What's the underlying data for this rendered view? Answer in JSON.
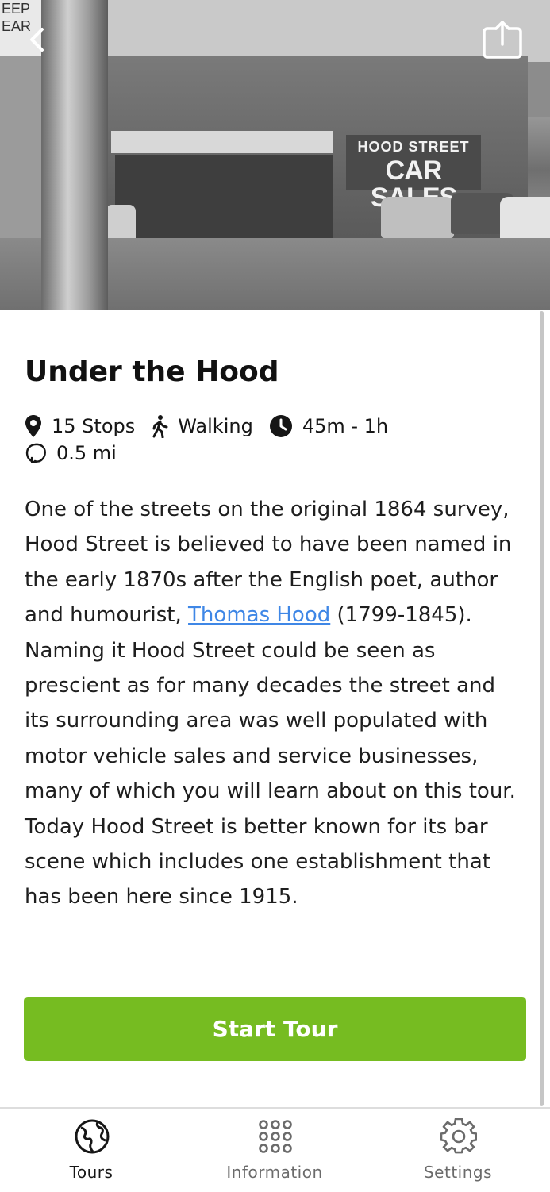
{
  "hero": {
    "sign_line1": "HOOD STREET",
    "sign_line2": "CAR SALES",
    "street_sign": "EEP EAR"
  },
  "tour": {
    "title": "Under the Hood",
    "stops": "15 Stops",
    "mode": "Walking",
    "duration": "45m - 1h",
    "distance": "0.5 mi",
    "description_before_link": "One of the streets on the original 1864 survey, Hood Street is believed to have been named in the early 1870s after the English poet, author and humourist, ",
    "description_link": "Thomas Hood",
    "description_after_link": " (1799-1845). Naming it Hood Street could be seen as prescient as for many decades the street and its surrounding area was well populated with motor vehicle sales and service businesses, many of which you will learn about on this tour. Today Hood Street is better known for its bar scene which includes one establishment that has been here since 1915.",
    "start_label": "Start Tour"
  },
  "tabs": [
    {
      "label": "Tours",
      "icon": "globe-icon",
      "active": true
    },
    {
      "label": "Information",
      "icon": "grid-dots-icon",
      "active": false
    },
    {
      "label": "Settings",
      "icon": "gear-icon",
      "active": false
    }
  ],
  "colors": {
    "accent_green": "#76bc21",
    "link_blue": "#3f87e6",
    "text": "#161616",
    "muted": "#6b6b6b"
  }
}
